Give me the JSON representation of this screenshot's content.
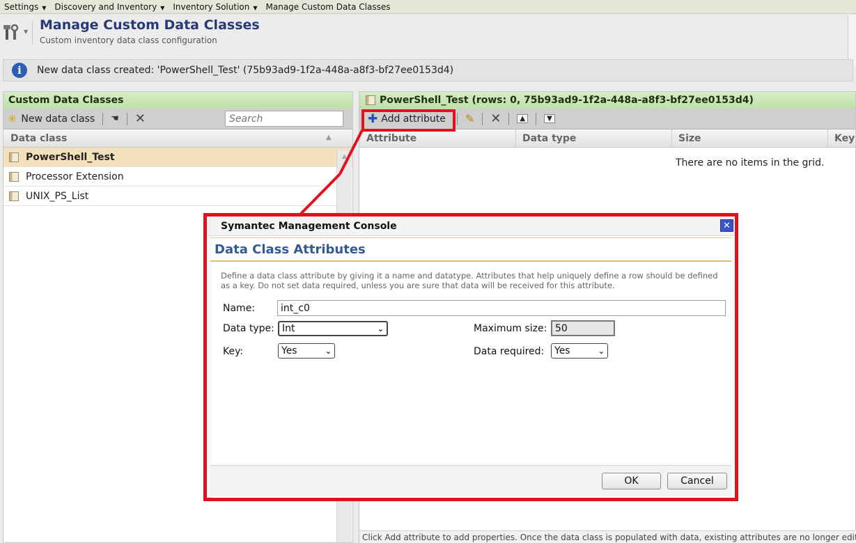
{
  "menubar": {
    "items": [
      {
        "label": "Settings",
        "has_caret": true
      },
      {
        "label": "Discovery and Inventory",
        "has_caret": true
      },
      {
        "label": "Inventory Solution",
        "has_caret": true
      },
      {
        "label": "Manage Custom Data Classes",
        "has_caret": false
      }
    ]
  },
  "header": {
    "title": "Manage Custom Data Classes",
    "subtitle": "Custom inventory data class configuration",
    "icon": "tools-icon"
  },
  "info_bar": {
    "icon": "info-icon",
    "text": "New data class created: 'PowerShell_Test' (75b93ad9-1f2a-448a-a8f3-bf27ee0153d4)"
  },
  "left_panel": {
    "title": "Custom Data Classes",
    "new_button_label": "New data class",
    "search_placeholder": "Search",
    "column_header": "Data class",
    "items": [
      {
        "label": "PowerShell_Test",
        "selected": true
      },
      {
        "label": "Processor Extension",
        "selected": false
      },
      {
        "label": "UNIX_PS_List",
        "selected": false
      }
    ]
  },
  "right_panel": {
    "title": "PowerShell_Test (rows: 0, 75b93ad9-1f2a-448a-a8f3-bf27ee0153d4)",
    "add_attribute_label": "Add attribute",
    "columns": [
      "Attribute",
      "Data type",
      "Size",
      "Key"
    ],
    "empty_text": "There are no items in the grid.",
    "footer_text": "Click Add attribute to add properties. Once the data class is populated with data, existing attributes are no longer editable."
  },
  "dialog": {
    "window_title": "Symantec Management Console",
    "heading": "Data Class Attributes",
    "description": "Define a data class attribute by giving it a name and datatype. Attributes that help uniquely define a row should be defined as a key. Do not set data required, unless you are sure that data will be received for this attribute.",
    "name_label": "Name:",
    "name_value": "int_c0",
    "data_type_label": "Data type:",
    "data_type_value": "Int",
    "max_size_label": "Maximum size:",
    "max_size_value": "50",
    "key_label": "Key:",
    "key_value": "Yes",
    "data_required_label": "Data required:",
    "data_required_value": "Yes",
    "ok_label": "OK",
    "cancel_label": "Cancel"
  },
  "colors": {
    "highlight": "#e2111f",
    "title_blue": "#283a76",
    "panel_header_green": "#c8e6b4",
    "selected_row": "#f4e0bb"
  }
}
